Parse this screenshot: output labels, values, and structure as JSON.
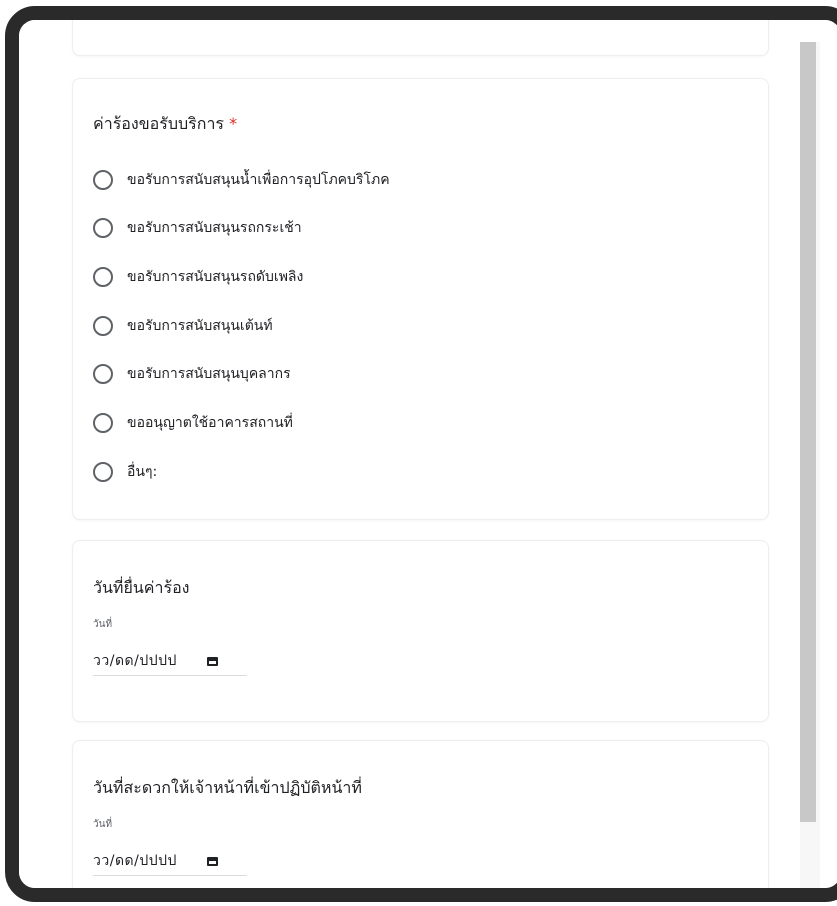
{
  "form": {
    "services_question": {
      "title": "ค่าร้องขอรับบริการ",
      "required_mark": "*",
      "options": [
        {
          "label": "ขอรับการสนับสนุนน้ำเพื่อการอุปโภคบริโภค"
        },
        {
          "label": "ขอรับการสนับสนุนรถกระเช้า"
        },
        {
          "label": "ขอรับการสนับสนุนรถดับเพลิง"
        },
        {
          "label": "ขอรับการสนับสนุนเต้นท์"
        },
        {
          "label": "ขอรับการสนับสนุนบุคลากร"
        },
        {
          "label": "ขออนุญาตใช้อาคารสถานที่"
        },
        {
          "label": "อื่นๆ:"
        }
      ]
    },
    "submit_date_question": {
      "title": "วันที่ยื่นค่าร้อง",
      "sub_label": "วันที่",
      "placeholder": "วว/ดด/ปปปป",
      "icon": "calendar-icon"
    },
    "visit_date_question": {
      "title": "วันที่สะดวกให้เจ้าหน้าที่เข้าปฏิบัติหน้าที่",
      "sub_label": "วันที่",
      "placeholder": "วว/ดด/ปปปป",
      "icon": "calendar-icon"
    }
  },
  "colors": {
    "required": "#d93025",
    "text": "#202124",
    "frame": "#2a2a2a"
  }
}
